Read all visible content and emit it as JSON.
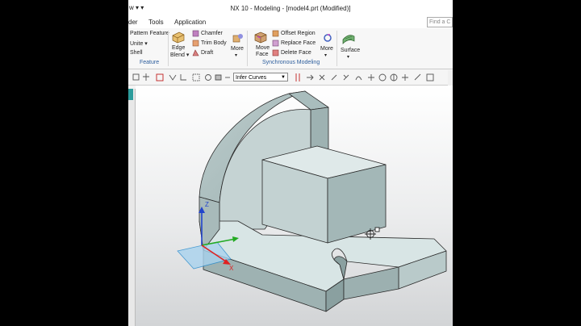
{
  "window": {
    "title": "NX 10 - Modeling - [model4.prt (Modified)]",
    "quick_access": "w ▾ ▾"
  },
  "menu": {
    "items": [
      "der",
      "Tools",
      "Application"
    ],
    "find_placeholder": "Find a C"
  },
  "ribbon": {
    "feature_group": {
      "pattern_feature": "Pattern Feature",
      "unite": "Unite ▾",
      "shell": "Shell",
      "label": "Feature"
    },
    "edge_group": {
      "edge_blend_line1": "Edge",
      "edge_blend_line2": "Blend ▾",
      "chamfer": "Chamfer",
      "trim_body": "Trim Body",
      "draft": "Draft"
    },
    "more1": "More",
    "sync_group": {
      "move_face_line1": "Move",
      "move_face_line2": "Face",
      "offset_region": "Offset Region",
      "replace_face": "Replace Face",
      "delete_face": "Delete Face",
      "label": "Synchronous Modeling"
    },
    "more2": "More",
    "surface": "Surface"
  },
  "toolbar2": {
    "infer_curves": "Infer Curves"
  },
  "axes": {
    "z": "Z",
    "y": "Y",
    "x": "X"
  },
  "colors": {
    "model_top": "#dbe7e7",
    "model_side_dark": "#96aaaa",
    "model_side_mid": "#a8bcbc",
    "viewport_top": "#ffffff",
    "viewport_bottom": "#d2d4d6",
    "x_axis": "#e02020",
    "y_axis": "#22aa22",
    "z_axis": "#2244cc",
    "group_label": "#2c5d9c"
  }
}
